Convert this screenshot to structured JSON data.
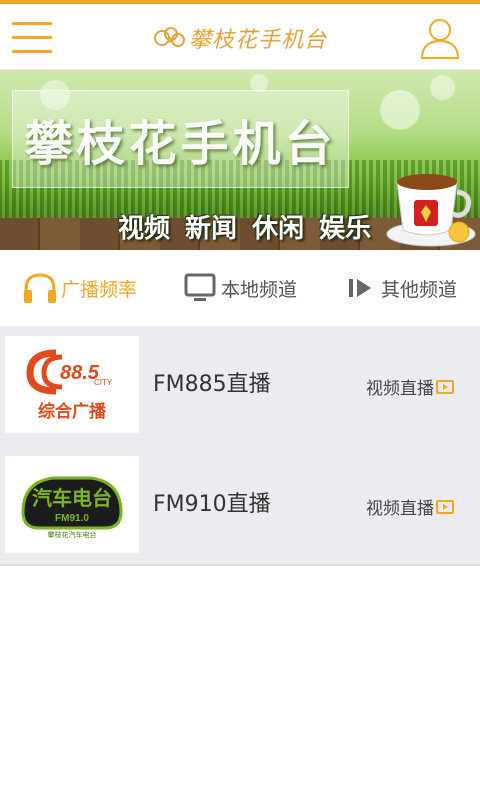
{
  "header": {
    "logo_text": "攀枝花手机台",
    "accent_color": "#f5a623"
  },
  "banner": {
    "title": "攀枝花手机台",
    "tagline": "视频 新闻 休闲 娱乐"
  },
  "tabs": [
    {
      "label": "广播频率",
      "icon": "headphones-icon",
      "active": true
    },
    {
      "label": "本地频道",
      "icon": "monitor-icon",
      "active": false
    },
    {
      "label": "其他频道",
      "icon": "play-icon",
      "active": false
    }
  ],
  "stations": [
    {
      "name": "FM885直播",
      "video_label": "视频直播",
      "logo": {
        "number": "88.5",
        "sub": "CITY",
        "caption": "综合广播"
      }
    },
    {
      "name": "FM910直播",
      "video_label": "视频直播",
      "logo": {
        "mark": "汽车电台",
        "freq": "FM91.0",
        "caption": "攀枝花汽车电台"
      }
    }
  ]
}
